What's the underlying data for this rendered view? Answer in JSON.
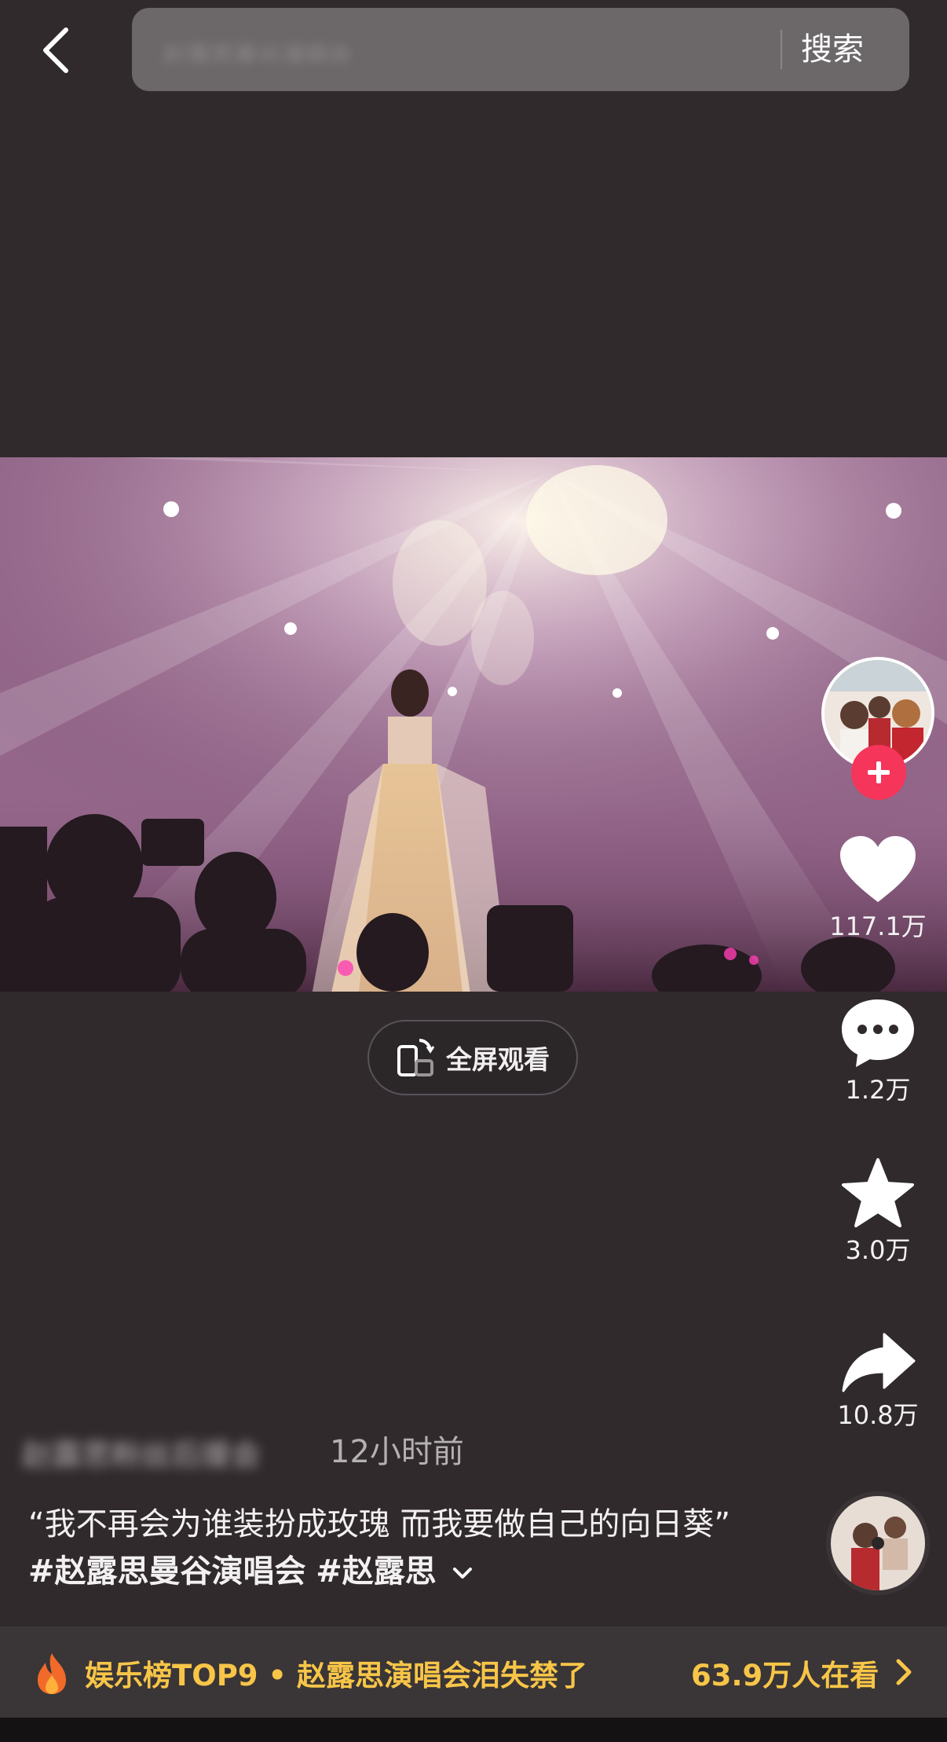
{
  "search": {
    "query": "赵露思曼谷演唱会",
    "button_label": "搜索"
  },
  "player": {
    "fullscreen_label": "全屏观看"
  },
  "actions": {
    "likes": "117.1万",
    "comments": "1.2万",
    "favorites": "3.0万",
    "shares": "10.8万"
  },
  "post": {
    "author": "赵露思粉丝后援会",
    "time": "12小时前",
    "caption_quote": "“我不再会为谁装扮成玫瑰 而我要做自己的向日葵”",
    "hashtags": [
      "#赵露思曼谷演唱会",
      "#赵露思"
    ]
  },
  "trending": {
    "title": "娱乐榜TOP9 • 赵露思演唱会泪失禁了",
    "viewers": "63.9万人在看"
  },
  "colors": {
    "accent": "#f5355a",
    "trend": "#f7c548",
    "background": "#302a2c"
  }
}
